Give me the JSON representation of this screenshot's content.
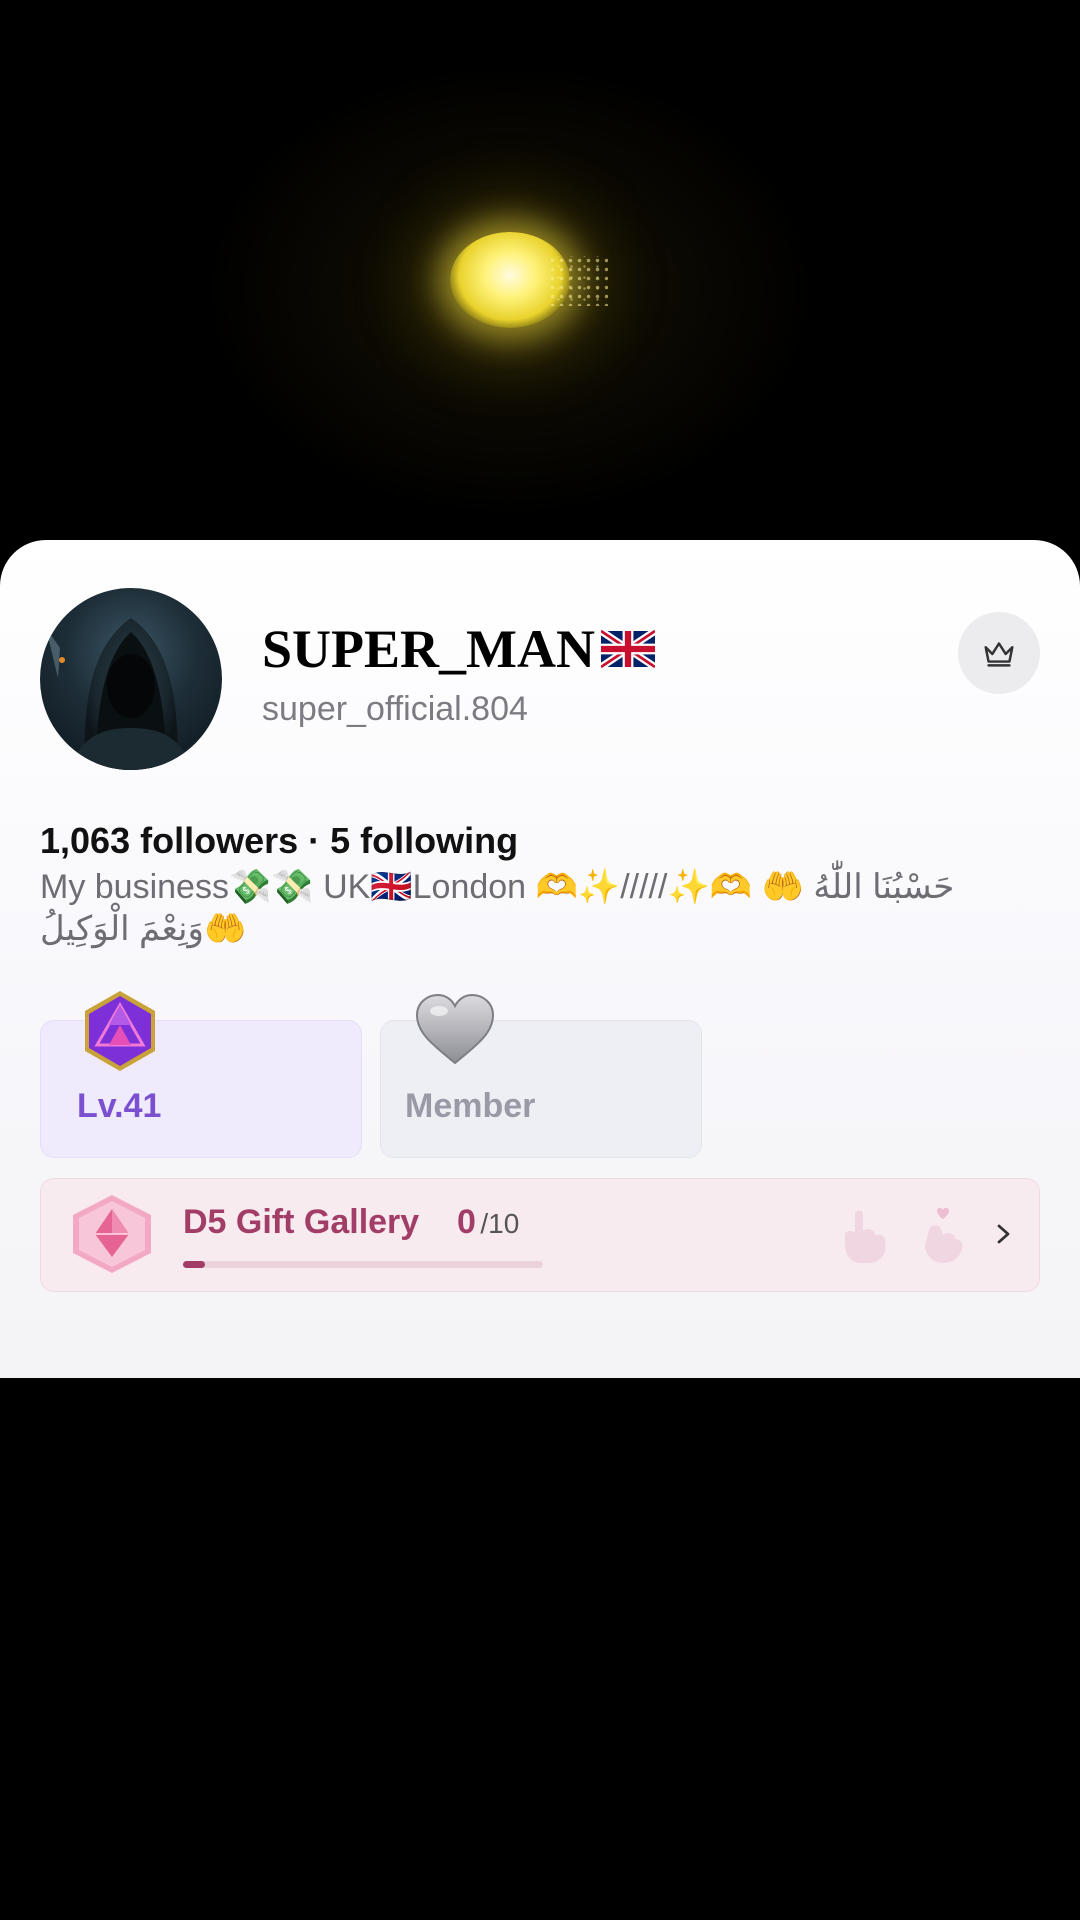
{
  "profile": {
    "display_name": "SUPER_MAN",
    "handle": "super_official.804",
    "stats": "1,063 followers · 5 following",
    "bio_line1": "My business💸💸  UK🇬🇧London 🫶✨/////✨🫶  🤲 حَسْبُنَا اللّٰهُ",
    "bio_line2": "وَنِعْمَ الْوَكِيلُ🤲"
  },
  "icons": {
    "name_flag": "uk-flag-icon",
    "top_right_button": "crown-icon",
    "level_badge": "purple-gem-icon",
    "member_badge": "gray-heart-icon",
    "gallery_badge": "pink-diamond-icon",
    "gallery_gifts": [
      "hand-gift-icon",
      "finger-heart-icon"
    ],
    "gallery_arrow": "chevron-right-icon"
  },
  "badges": {
    "level_label": "Lv.41",
    "member_label": "Member"
  },
  "gallery": {
    "title": "D5 Gift Gallery",
    "current": "0",
    "total": "/10",
    "progress_fraction": 0.06
  },
  "colors": {
    "level_accent": "#7a4fd0",
    "gallery_accent": "#a13d66",
    "member_text": "#9a9aa6",
    "orb_glow": "#fff27a"
  }
}
